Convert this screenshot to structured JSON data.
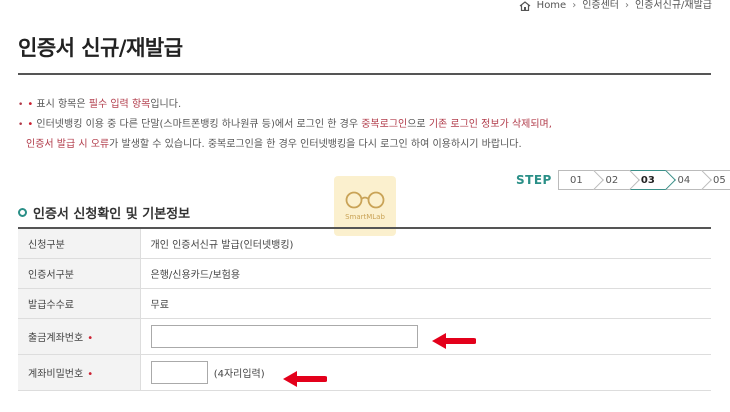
{
  "breadcrumb": {
    "home": "Home",
    "items": [
      "인증센터",
      "인증서신규/재발급"
    ]
  },
  "page_title": "인증서 신규/재발급",
  "notes": {
    "line1_pre": "표시 항목은",
    "line1_req": "필수 입력 항목",
    "line1_post": "입니다.",
    "line2_pre": "인터넷뱅킹 이용 중 다른 단말(스마트폰뱅킹 하나원큐 등)에서 로그인 한 경우",
    "line2_em1": "중복로그인",
    "line2_mid": "으로",
    "line2_em2": "기존 로그인 정보가 삭제되며,",
    "line3_em": "인증서 발급 시 오류",
    "line3_post": "가 발생할 수 있습니다. 중복로그인을 한 경우 인터넷뱅킹을 다시 로그인 하여 이용하시기 바랍니다.",
    "bullet": "•",
    "req_mark": "•"
  },
  "steps": {
    "label": "STEP",
    "items": [
      "01",
      "02",
      "03",
      "04",
      "05"
    ],
    "active": "03"
  },
  "watermark": "SmartMLab",
  "section_title": "인증서 신청확인 및 기본정보",
  "rows": {
    "type_label": "신청구분",
    "type_value": "개인 인증서신규 발급(인터넷뱅킹)",
    "cert_label": "인증서구분",
    "cert_value": "은행/신용카드/보험용",
    "fee_label": "발급수수료",
    "fee_value": "무료",
    "account_label": "출금계좌번호",
    "account_value": "",
    "password_label": "계좌비밀번호",
    "password_value": "",
    "password_note": "(4자리입력)",
    "req_mark": "•"
  },
  "colors": {
    "accent": "#2a8f87",
    "required": "#cc2233",
    "arrow": "#e3001b"
  }
}
